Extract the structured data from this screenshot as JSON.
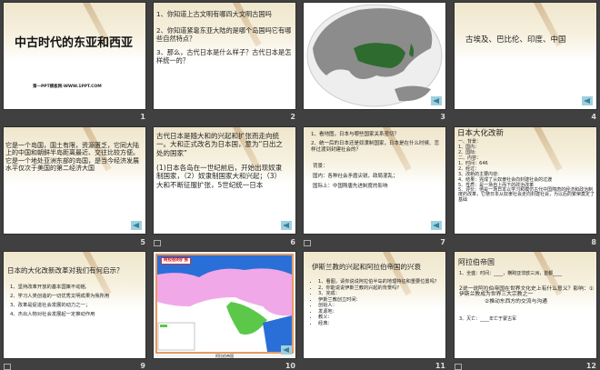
{
  "slides": [
    {
      "number": "1",
      "title": "中古时代的东亚和西亚",
      "footer": "第一PPT模板网-WWW.1PPT.COM"
    },
    {
      "number": "2",
      "lines": [
        "1、你知道上古文明有哪四大文明古国吗",
        "2、你知道紧靠东亚大陆的是哪个岛国吗它有哪些自然特点？",
        "3、那么，古代日本是什么样子？古代日本是怎样统一的？"
      ]
    },
    {
      "number": "3",
      "image": "asia-globe-map"
    },
    {
      "number": "4",
      "text": "古埃及、巴比伦、印度、中国"
    },
    {
      "number": "5",
      "text": "它是一个岛国，国土有限，资源匮乏，它同大陆上的中国和朝鲜半岛距离最近、交往比较方便。它是一个地处亚洲东部的岛国，是当今经济发展水平仅次于美国的第二经济大国"
    },
    {
      "number": "6",
      "para1": "古代日本是随大和的兴起和扩张而走向统一。大和正式改名为日本国，意为“日出之处的国家”",
      "para2": "(1)日本各岛在一世纪前后，开始出现奴隶制国家，（2）奴隶制国家大和兴起；（3）大和不断征服扩张，5世纪统一日本"
    },
    {
      "number": "7",
      "lines": [
        "1、看地图，日本与哪些国家关系密切？",
        "2、统一后的日本还是奴隶制国家，日本是在什么时候、怎样过渡到封建社会的？",
        "背景：",
        "国内：各种社会矛盾尖锐，政局混乱；",
        "国际上：中国隋唐先进制度的影响"
      ]
    },
    {
      "number": "8",
      "title": "日本大化改新",
      "lines": [
        "一、背景：",
        "1、国内：",
        "2、国际:",
        "二、内容：",
        "1、时间：646",
        "2、经过：",
        "3、改新的主要内容:",
        "4、结果：完成了从奴隶社会向封建社会的过渡",
        "5、性质：是一场自上而下的政治改革",
        "5、评价：他是一场日本以学习和模仿古代中国隋唐的经济和政治制度的改革，它使日本从奴隶社会走向封建社会，为以后的繁荣奠定了基础"
      ]
    },
    {
      "number": "9",
      "title": "日本的大化改新改革对我们有何启示？",
      "lines": [
        "1、坚持改革开放的基本国策不动摇,",
        "2、学习人类创造的一切优秀文明成果为我所用",
        "3、改革是促进社会发展的动力之一；",
        "4、杰出人物对社会发展起一定推动作用"
      ]
    },
    {
      "number": "10",
      "map_title": "阿拉伯的扩张",
      "caption": "阿拉伯帝国"
    },
    {
      "number": "11",
      "title": "伊斯兰教的兴起和阿拉伯帝国的兴衰",
      "lines": [
        "1、看图，请你说说阿拉伯半岛的地理特征和重要位置吗？",
        "2、你能说说伊斯兰教的兴起的背景吗?",
        "3、完成：",
        "伊斯兰教创立时间：",
        "创始人：",
        "发源地：",
        "教义：",
        "经典："
      ]
    },
    {
      "number": "12",
      "title": "阿拉伯帝国",
      "lines": [
        "1、全盛：时间：____，横跨亚非欧三洲，首都____",
        "2说一说阿拉伯帝国在世界文化史上有什么意义？影响：①伊斯兰教成为世界三大宗教之一",
        "②推动东西方的交流与沟通",
        "3、灭亡：____年亡于蒙古军"
      ]
    }
  ],
  "colors": {
    "background": "#404040",
    "china": "#2e6b2e",
    "back_button": "#9fd0de"
  }
}
